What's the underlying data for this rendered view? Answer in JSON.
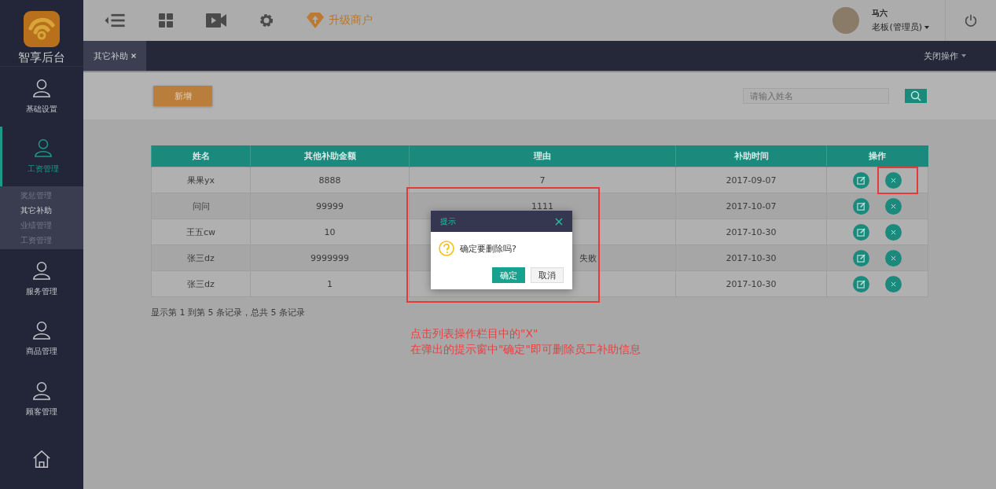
{
  "sidebar": {
    "logo_text": "智享后台",
    "items": [
      {
        "label": "基础设置",
        "selected": false,
        "kind": "person"
      },
      {
        "label": "工资管理",
        "selected": true,
        "kind": "person",
        "children": [
          {
            "label": "奖惩管理",
            "selected": false
          },
          {
            "label": "其它补助",
            "selected": true
          },
          {
            "label": "业绩管理",
            "selected": false
          },
          {
            "label": "工资管理",
            "selected": false
          }
        ]
      },
      {
        "label": "服务管理",
        "selected": false,
        "kind": "person"
      },
      {
        "label": "商品管理",
        "selected": false,
        "kind": "person"
      },
      {
        "label": "顾客管理",
        "selected": false,
        "kind": "person"
      },
      {
        "selected": false,
        "kind": "home"
      }
    ]
  },
  "topbar": {
    "upgrade": "升级商户",
    "user_name": "马六",
    "user_role": "老板(管理员)"
  },
  "tabs": [
    {
      "label": "其它补助",
      "selected": true
    }
  ],
  "close_menu": "关闭操作",
  "toolbar": {
    "add_button": "新增",
    "search": {
      "placeholder": "请输入姓名"
    }
  },
  "table": {
    "columns": [
      "姓名",
      "其他补助金额",
      "理由",
      "补助时间",
      "操作"
    ],
    "rows": [
      {
        "name": "果果yx",
        "amount": "8888",
        "reason": "7",
        "date": "2017-09-07"
      },
      {
        "name": "问问",
        "amount": "99999",
        "reason": "1111",
        "date": "2017-10-07"
      },
      {
        "name": "王五cw",
        "amount": "10",
        "date": "2017-10-30"
      },
      {
        "name": "张三dz",
        "amount": "9999999",
        "reason_visible_end": "失败",
        "date": "2017-10-30"
      },
      {
        "name": "张三dz",
        "amount": "1",
        "date": "2017-10-30"
      }
    ]
  },
  "summary": "显示第 1 到第 5 条记录，总共 5 条记录",
  "dialog": {
    "title": "提示",
    "message": "确定要删除吗?",
    "confirm": "确定",
    "cancel": "取消"
  },
  "annotation": [
    "点击列表操作栏目中的\"X\"",
    "在弹出的提示窗中\"确定\"即可删除员工补助信息"
  ]
}
